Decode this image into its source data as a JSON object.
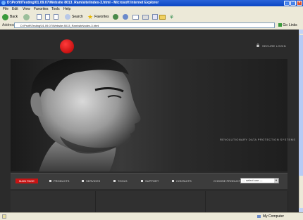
{
  "window": {
    "title": "D:\\Profit\\Testing\\01.09.07\\Website 8013_Ram\\site\\index-3.html - Microsoft Internet Explorer"
  },
  "menu": [
    "File",
    "Edit",
    "View",
    "Favorites",
    "Tools",
    "Help"
  ],
  "toolbar": {
    "back": "Back",
    "search": "Search",
    "favorites": "Favorites"
  },
  "address": {
    "label": "Address",
    "value": "D:\\Profit\\Testing\\01.09.07\\Website 8013_Ram\\site\\index-3.html",
    "go": "Go",
    "links": "Links"
  },
  "page": {
    "secure_login": "SECURE LOGIN",
    "tagline": "REVOLUTIONARY DATA PROTECTION SYSTEMS",
    "nav": [
      "MAIN PAGE",
      "PRODUCTS",
      "SERVICES",
      "TOOLS",
      "SUPPORT",
      "CONTACTS"
    ],
    "choose_product": "CHOOSE PRODUCT",
    "select_value": "--- select one ---"
  },
  "status": {
    "right": "My Computer"
  },
  "colors": {
    "accent": "#c81414",
    "logo": "#d41a1a",
    "page_bg": "#2b2b2b"
  }
}
